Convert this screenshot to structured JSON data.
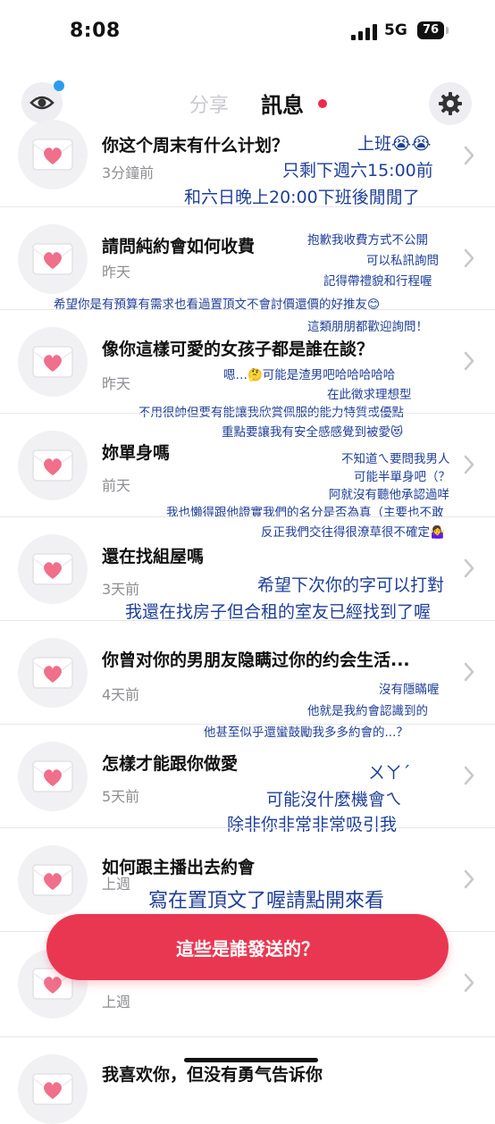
{
  "status_bar": {
    "time": "8:08",
    "network": "5G",
    "battery": "76"
  },
  "header": {
    "tab_share": "分享",
    "tab_messages": "訊息"
  },
  "messages": [
    {
      "question": "你这个周末有什么计划？",
      "time": "3分鐘前",
      "notes": [
        "上班😭😭",
        "只剩下週六15:00前",
        "和六日晚上20:00下班後閒閒了"
      ]
    },
    {
      "question": "請問純約會如何收費",
      "time": "昨天",
      "notes": [
        "抱歉我收費方式不公開",
        "可以私訊詢問",
        "記得帶禮貌和行程喔",
        "希望你是有預算有需求也看過置頂文不會討價還價的好推友😊",
        "這類朋朋都歡迎詢問！"
      ]
    },
    {
      "question": "像你這樣可愛的女孩子都是誰在談？",
      "time": "昨天",
      "notes": [
        "嗯…🤔可能是渣男吧哈哈哈哈哈",
        "在此徵求理想型",
        "不用很帥但要有能讓我欣賞佩服的能力特質或優點",
        "重點要讓我有安全感感覺到被愛😻"
      ]
    },
    {
      "question": "妳單身嗎",
      "time": "前天",
      "notes": [
        "不知道ㄟ要問我男人",
        "可能半單身吧（？",
        "阿就沒有聽他承認過咩",
        "我也懶得跟他證實我們的名分是否為真（主要也不敢",
        "反正我們交往得很潦草很不確定🤷‍♀️"
      ]
    },
    {
      "question": "還在找組屋嗎",
      "time": "3天前",
      "notes": [
        "希望下次你的字可以打對",
        "我還在找房子但合租的室友已經找到了喔"
      ]
    },
    {
      "question": "你曾对你的男朋友隐瞒过你的约会生活...",
      "time": "4天前",
      "notes": [
        "沒有隱瞞喔",
        "他就是我約會認識到的",
        "他甚至似乎還蠻鼓勵我多多約會的...？"
      ]
    },
    {
      "question": "怎樣才能跟你做愛",
      "time": "5天前",
      "notes": [
        "ㄨㄚˊ",
        "可能沒什麼機會ㄟ",
        "除非你非常非常吸引我"
      ]
    },
    {
      "question": "如何跟主播出去約會",
      "time": "上週",
      "notes": [
        "寫在置頂文了喔請點開來看"
      ]
    },
    {
      "question": "",
      "time": "上週",
      "notes": []
    },
    {
      "question": "我喜欢你，但没有勇气告诉你",
      "time": "",
      "notes": []
    }
  ],
  "cta_button": "這些是誰發送的？",
  "colors": {
    "accent": "#ea3751",
    "note_ink": "#1f3f97",
    "dot_blue": "#2f9bf0"
  },
  "icons": [
    "eye-icon",
    "gear-icon",
    "heart-envelope-icon",
    "chevron-right-icon",
    "signal-icon",
    "battery-icon"
  ]
}
